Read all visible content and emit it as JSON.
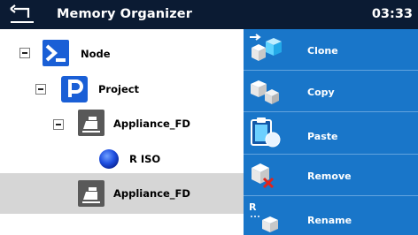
{
  "header": {
    "title": "Memory Organizer",
    "time": "03:33",
    "bg_color": "#0b1b33"
  },
  "tree": {
    "nodes": [
      {
        "label": "Node",
        "icon": "node-icon",
        "level": 0,
        "expanded": true
      },
      {
        "label": "Project",
        "icon": "project-icon",
        "level": 1,
        "expanded": true
      },
      {
        "label": "Appliance_FD",
        "icon": "appliance-icon",
        "level": 2,
        "expanded": true
      },
      {
        "label": "R ISO",
        "icon": "measurement-dot-icon",
        "level": 3
      },
      {
        "label": "Appliance_FD",
        "icon": "appliance-icon",
        "level": 2,
        "selected": true
      }
    ]
  },
  "actions": {
    "clone": "Clone",
    "copy": "Copy",
    "paste": "Paste",
    "remove": "Remove",
    "rename": "Rename",
    "panel_color": "#1976c9"
  }
}
